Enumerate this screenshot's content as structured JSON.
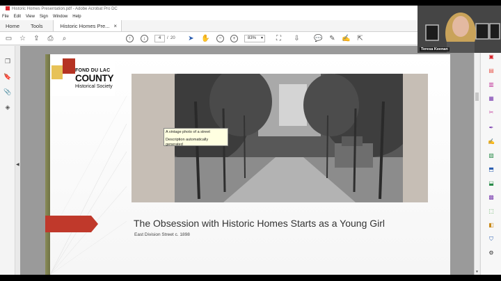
{
  "window": {
    "title": "Historic Homes Presentation.pdf - Adobe Acrobat Pro DC"
  },
  "menu": [
    "File",
    "Edit",
    "View",
    "Sign",
    "Window",
    "Help"
  ],
  "tabs": {
    "home": "Home",
    "tools": "Tools",
    "document": "Historic Homes Pre...",
    "close_glyph": "×"
  },
  "toolbar": {
    "current_page": "4",
    "page_separator": "/",
    "total_pages": "20",
    "zoom": "83%",
    "dropdown_glyph": "▾"
  },
  "slide": {
    "logo": {
      "line1": "FOND DU LAC",
      "line2": "COUNTY",
      "line3": "Historical Society"
    },
    "tooltip": {
      "line1": "A vintage photo of a street",
      "line2": "Description automatically generated"
    },
    "title": "The Obsession with Historic Homes Starts as a Young Girl",
    "subtitle": "East Division Street c. 1898"
  },
  "webcam": {
    "participant_name": "Teresa Keenan"
  },
  "colors": {
    "accent_red": "#d8262d",
    "sidebar_bar": "#7c7e4d",
    "arrow_red": "#c0392b",
    "logo_yellow": "#e7c257"
  }
}
